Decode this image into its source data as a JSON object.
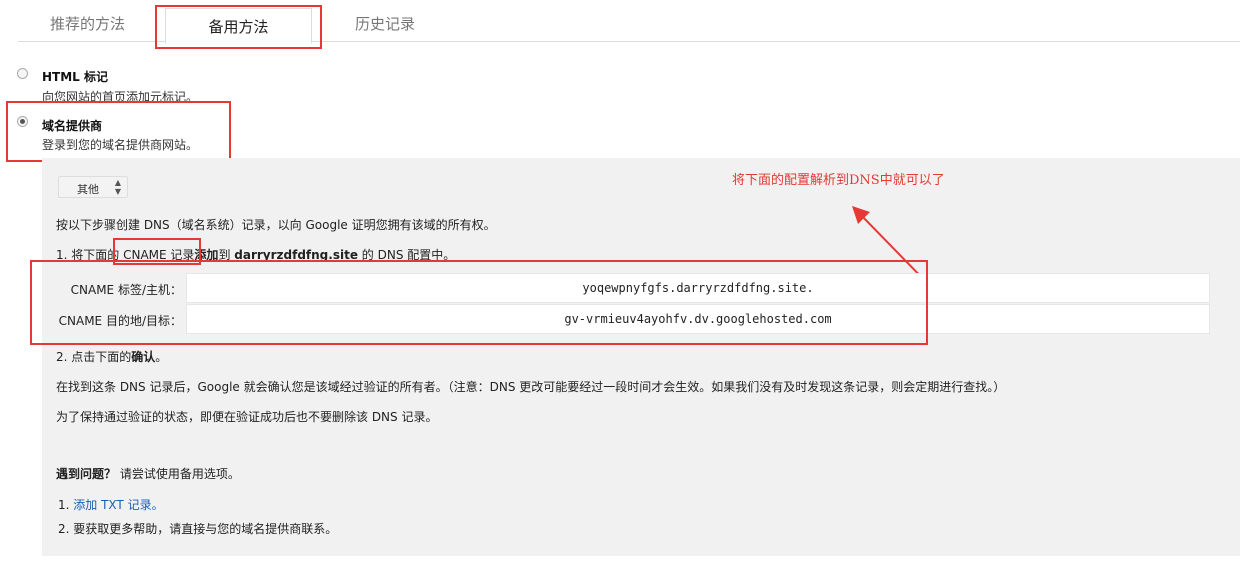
{
  "tabs": [
    {
      "label": "推荐的方法"
    },
    {
      "label": "备用方法"
    },
    {
      "label": "历史记录"
    }
  ],
  "options": [
    {
      "title": "HTML 标记",
      "desc": "向您网站的首页添加元标记。"
    },
    {
      "title": "域名提供商",
      "desc": "登录到您的域名提供商网站。"
    }
  ],
  "panel": {
    "provider_select": "其他",
    "intro": "按以下步骤创建 DNS（域名系统）记录，以向 Google 证明您拥有该域的所有权。",
    "step1": {
      "a": "1. 将下面的 ",
      "b": "CNAME 记录",
      "c": "添加",
      "d": "到 ",
      "e": "darryrzdfdfng.site",
      "f": " 的 DNS 配置中。"
    },
    "records": [
      {
        "label": "CNAME 标签/主机：",
        "value": "yoqewpnyfgfs.darryrzdfdfng.site."
      },
      {
        "label": "CNAME 目的地/目标：",
        "value": "gv-vrmieuv4ayohfv.dv.googlehosted.com"
      }
    ],
    "step2": {
      "a": "2. 点击下面的",
      "b": "确认",
      "c": "。"
    },
    "after_found": "在找到这条 DNS 记录后，Google 就会确认您是该域经过验证的所有者。（注意：DNS 更改可能要经过一段时间才会生效。如果我们没有及时发现这条记录，则会定期进行查找。）",
    "keep": "为了保持通过验证的状态，即便在验证成功后也不要删除该 DNS 记录。",
    "problem": {
      "a": "遇到问题？",
      "b": " 请尝试使用备用选项。"
    },
    "help1": {
      "num": "1. ",
      "link": "添加 TXT 记录。"
    },
    "help2": "2. 要获取更多帮助，请直接与您的域名提供商联系。"
  },
  "annotation": "将下面的配置解析到DNS中就可以了",
  "colors": {
    "annotation_red": "#e53935",
    "link_blue": "#1a5fb4",
    "panel_gray": "#f1f1f1"
  }
}
